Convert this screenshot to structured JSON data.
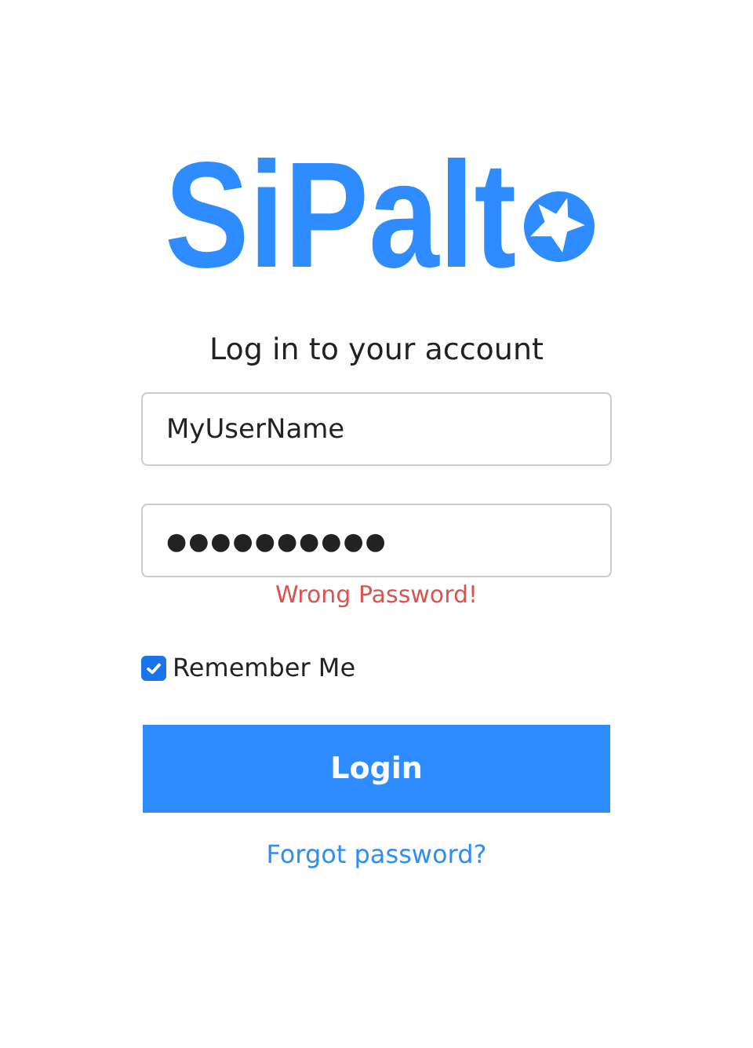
{
  "logo": {
    "text": "SiPalt"
  },
  "heading": "Log in to your account",
  "username": {
    "value": "MyUserName"
  },
  "password": {
    "value": "●●●●●●●●●●"
  },
  "error": "Wrong Password!",
  "remember": {
    "label": "Remember Me",
    "checked": true
  },
  "login_button": "Login",
  "forgot_link": "Forgot password?"
}
